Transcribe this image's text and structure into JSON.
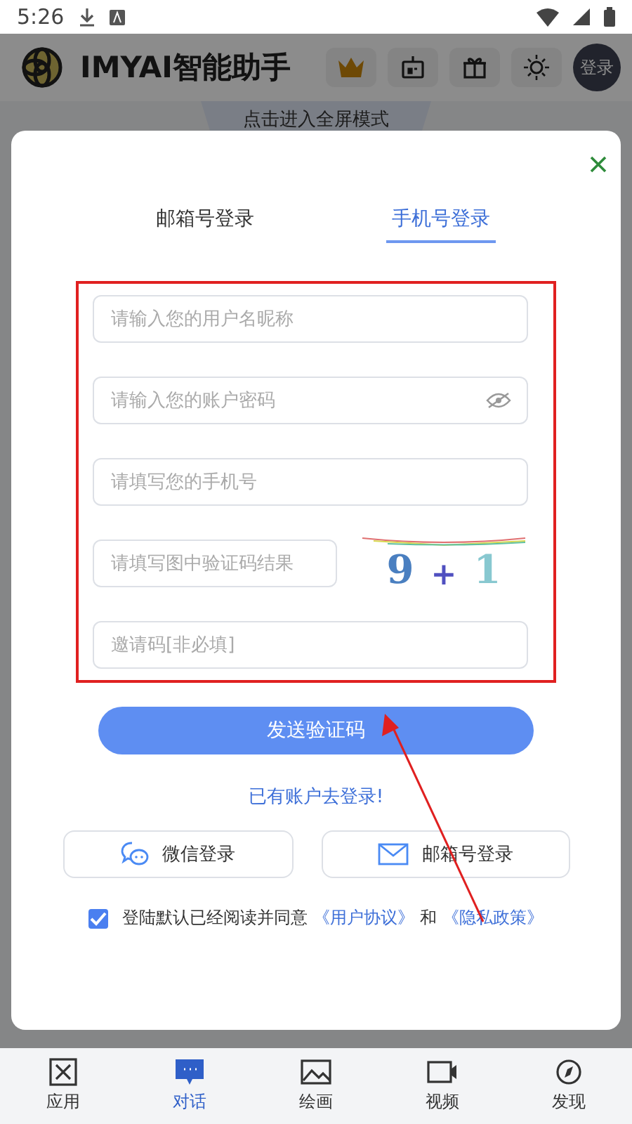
{
  "status_bar": {
    "time": "5:26"
  },
  "header": {
    "app_name": "IMYAI智能助手",
    "login_label": "登录",
    "fullscreen_tab": "点击进入全屏模式"
  },
  "dialog": {
    "tabs": [
      {
        "label": "邮箱号登录",
        "selected": false
      },
      {
        "label": "手机号登录",
        "selected": true
      }
    ],
    "fields": [
      {
        "kind": "text",
        "placeholder": "请输入您的用户名昵称"
      },
      {
        "kind": "password",
        "placeholder": "请输入您的账户密码"
      },
      {
        "kind": "text",
        "placeholder": "请填写您的手机号"
      },
      {
        "kind": "captcha",
        "placeholder": "请填写图中验证码结果",
        "captcha": [
          "9",
          "+",
          "1"
        ]
      },
      {
        "kind": "text",
        "placeholder": "邀请码[非必填]"
      }
    ],
    "submit": "发送验证码",
    "login_link": "已有账户去登录!",
    "alt_logins": [
      {
        "kind": "wechat",
        "label": "微信登录"
      },
      {
        "kind": "email",
        "label": "邮箱号登录"
      }
    ],
    "agreement": {
      "checked": true,
      "text": "登陆默认已经阅读并同意",
      "link1": "《用户协议》",
      "and": "和",
      "link2": "《隐私政策》"
    }
  },
  "bottom_nav": [
    {
      "kind": "apps",
      "label": "应用",
      "selected": false
    },
    {
      "kind": "chat",
      "label": "对话",
      "selected": true
    },
    {
      "kind": "image",
      "label": "绘画",
      "selected": false
    },
    {
      "kind": "video",
      "label": "视频",
      "selected": false
    },
    {
      "kind": "discover",
      "label": "发现",
      "selected": false
    }
  ]
}
